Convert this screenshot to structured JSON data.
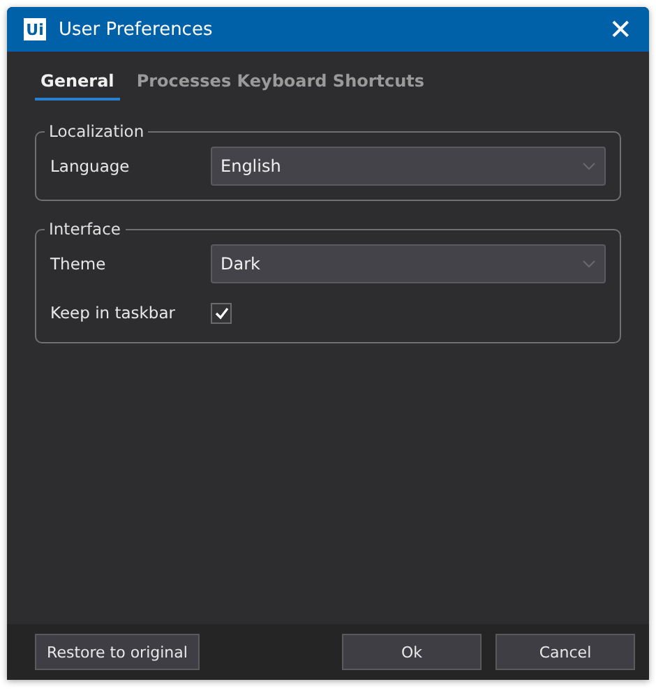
{
  "window": {
    "title": "User Preferences",
    "logo": "Ui",
    "close": "✕"
  },
  "tabs": [
    {
      "label": "General",
      "selected": true
    },
    {
      "label": "Processes Keyboard Shortcuts",
      "selected": false
    }
  ],
  "groups": [
    {
      "title": "Localization",
      "rows": [
        {
          "kind": "select",
          "label": "Language",
          "value": "English"
        }
      ]
    },
    {
      "title": "Interface",
      "rows": [
        {
          "kind": "select",
          "label": "Theme",
          "value": "Dark"
        },
        {
          "kind": "checkbox",
          "label": "Keep in taskbar",
          "checked": true
        }
      ]
    }
  ],
  "footer": {
    "restore": "Restore to original",
    "ok": "Ok",
    "cancel": "Cancel"
  }
}
